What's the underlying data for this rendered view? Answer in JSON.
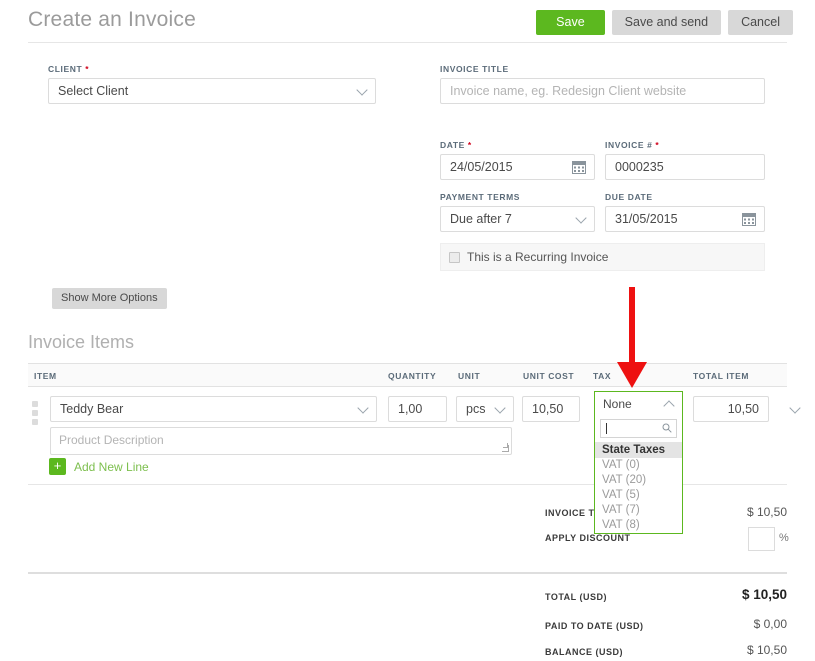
{
  "header": {
    "title": "Create an Invoice",
    "buttons": [
      {
        "label": "Save",
        "kind": "primary"
      },
      {
        "label": "Save and send",
        "kind": "secondary"
      },
      {
        "label": "Cancel",
        "kind": "secondary"
      }
    ]
  },
  "form": {
    "client": {
      "label": "CLIENT",
      "required": true,
      "value": "Select Client"
    },
    "invoice_title": {
      "label": "INVOICE TITLE",
      "placeholder": "Invoice name, eg. Redesign Client website",
      "value": ""
    },
    "date": {
      "label": "DATE",
      "required": true,
      "value": "24/05/2015"
    },
    "invoice_number": {
      "label": "INVOICE #",
      "required": true,
      "value": "0000235"
    },
    "payment_terms": {
      "label": "PAYMENT TERMS",
      "value": "Due after 7"
    },
    "due_date": {
      "label": "DUE DATE",
      "value": "31/05/2015"
    },
    "recurring": {
      "label": "This is a Recurring Invoice",
      "checked": false
    },
    "show_more": "Show More Options"
  },
  "items_section": {
    "title": "Invoice Items",
    "columns": [
      "ITEM",
      "QUANTITY",
      "UNIT",
      "UNIT COST",
      "TAX",
      "TOTAL ITEM"
    ],
    "rows": [
      {
        "item": "Teddy Bear",
        "description_placeholder": "Product Description",
        "quantity": "1,00",
        "unit": "pcs",
        "unit_cost": "10,50",
        "tax": "None",
        "total_item": "10,50"
      }
    ],
    "add_new_line": "Add New Line",
    "add_icon": "plus-icon"
  },
  "tax_dropdown": {
    "selected": "None",
    "search_value": "",
    "search_icon": "magnifier-icon",
    "toggle_icon": "chevron-up-icon",
    "group_label": "State Taxes",
    "options": [
      "VAT (0)",
      "VAT (20)",
      "VAT (5)",
      "VAT (7)",
      "VAT (8)"
    ],
    "border_color": "#5cb81f"
  },
  "totals": {
    "invoice_total": {
      "label": "INVOICE TOTAL",
      "value": "$ 10,50"
    },
    "apply_discount": {
      "label": "APPLY DISCOUNT",
      "value": "",
      "suffix": "%"
    },
    "total": {
      "label": "TOTAL (USD)",
      "value": "$ 10,50"
    },
    "paid_to_date": {
      "label": "PAID TO DATE (USD)",
      "value": "$ 0,00"
    },
    "balance": {
      "label": "BALANCE (USD)",
      "value": "$ 10,50"
    }
  },
  "annotation": {
    "arrow": "red-down-arrow",
    "color": "#ee1111"
  }
}
